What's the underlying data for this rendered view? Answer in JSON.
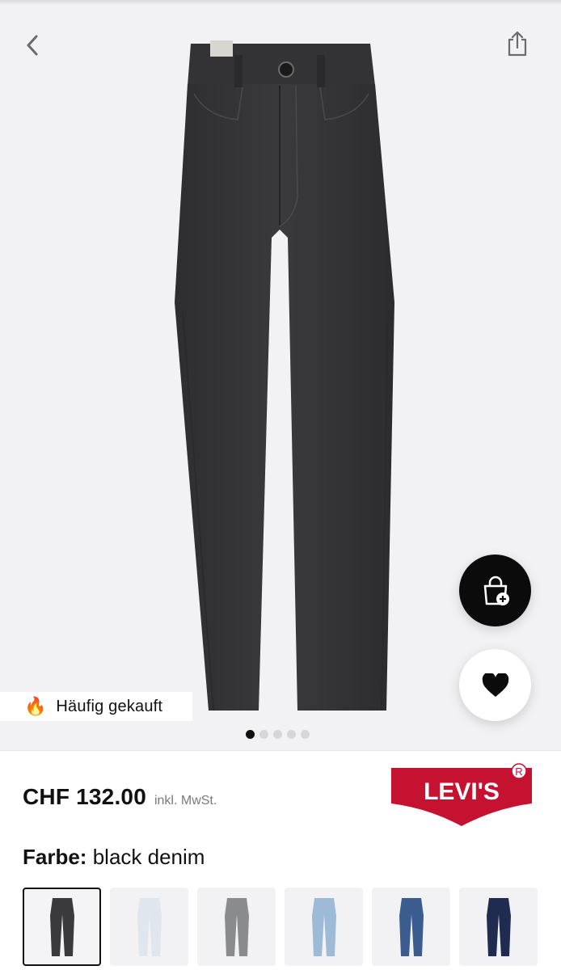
{
  "product": {
    "badge_icon": "fire-icon",
    "badge_text": "Häufig gekauft",
    "image_count": 5,
    "active_image_index": 0
  },
  "header": {
    "back_icon": "chevron-left-icon",
    "share_icon": "share-icon"
  },
  "actions": {
    "add_to_cart_icon": "bag-plus-icon",
    "wishlist_icon": "heart-icon"
  },
  "pricing": {
    "price": "CHF 132.00",
    "vat_note": "inkl. MwSt."
  },
  "brand": {
    "name": "LEVI'S",
    "logo_color": "#c41230"
  },
  "color": {
    "label": "Farbe:",
    "value": "black denim",
    "swatches": [
      {
        "name": "black denim",
        "hex": "#3a3a3c",
        "selected": true
      },
      {
        "name": "light bleached",
        "hex": "#dfe6ee",
        "selected": false
      },
      {
        "name": "grey",
        "hex": "#8a8b8c",
        "selected": false
      },
      {
        "name": "light blue",
        "hex": "#9dbad6",
        "selected": false
      },
      {
        "name": "mid blue",
        "hex": "#3a5c8f",
        "selected": false
      },
      {
        "name": "dark navy",
        "hex": "#1f2b4f",
        "selected": false
      }
    ]
  }
}
